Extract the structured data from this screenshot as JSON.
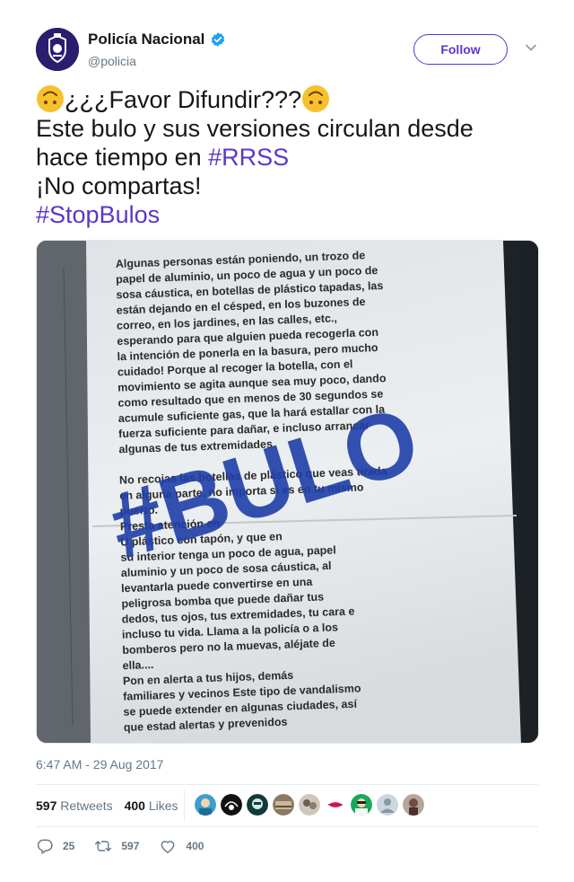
{
  "author": {
    "display_name": "Policía Nacional",
    "handle": "@policia",
    "verified": true
  },
  "follow_label": "Follow",
  "tweet": {
    "line1_text": "¿¿¿Favor Difundir???",
    "line2_text": "Este bulo y sus versiones circulan desde",
    "line3_text": "hace tiempo en ",
    "line3_hashtag": "#RRSS",
    "line4_text": "¡No compartas!",
    "line5_hashtag": "#StopBulos",
    "emoji": "upside-down-face"
  },
  "media": {
    "stamp": "#BULO",
    "lines": [
      "Algunas personas están poniendo, un trozo de",
      "papel de aluminio, un poco de agua y un poco de",
      "sosa cáustica, en botellas de plástico tapadas, las",
      "están dejando en el césped, en los buzones de",
      "correo, en los jardines, en las calles, etc.,",
      "esperando para que alguien pueda recogerla con",
      "la intención de ponerla en la basura, pero mucho",
      "cuidado! Porque al recoger la botella, con el",
      "movimiento se agita aunque sea muy poco, dando",
      "como resultado que en menos de 30 segundos se",
      "acumule suficiente gas, que la hará estallar con la",
      "fuerza suficiente para dañar, e incluso arrancar",
      "algunas de tus extremidades.",
      "",
      "No recojas las botellas de plástico que veas tirada",
      "en alguna parte, no importa si es en tu mismo",
      "puerto.",
      "Presta atención en",
      "U          plástico con tapón, y que en",
      "su interior tenga un poco de agua, papel",
      "aluminio y un poco de sosa cáustica, al",
      "levantarla puede convertirse en una",
      "peligrosa bomba que puede dañar tus",
      "dedos, tus ojos, tus extremidades, tu cara e",
      "incluso tu vida. Llama a la policía o a los",
      "bomberos pero no la muevas, aléjate de",
      "ella....",
      "   Pon en alerta a tus hijos, demás",
      "familiares y vecinos Este tipo de vandalismo",
      "se puede extender en algunas ciudades, así",
      "que estad alertas y prevenidos"
    ]
  },
  "timestamp": "6:47 AM - 29 Aug 2017",
  "stats": {
    "retweets_count": "597",
    "retweets_label": "Retweets",
    "likes_count": "400",
    "likes_label": "Likes"
  },
  "actions": {
    "reply_count": "25",
    "retweet_count": "597",
    "like_count": "400"
  },
  "colors": {
    "accent": "#5b36c9",
    "verified": "#1da1f2",
    "muted": "#657786",
    "stamp": "#1f3fa8"
  }
}
